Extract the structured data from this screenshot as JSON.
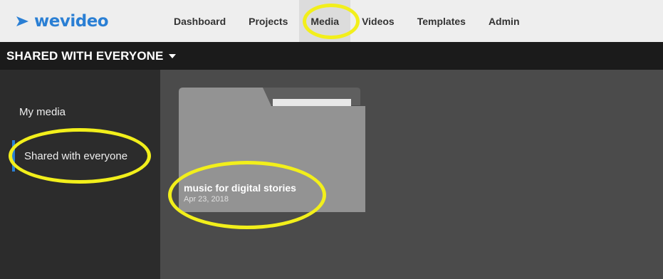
{
  "app": {
    "logo_text": "wevideo",
    "colors": {
      "brand_blue": "#2a7fd4",
      "highlight_yellow": "#f2ef1b"
    }
  },
  "nav": {
    "items": [
      {
        "label": "Dashboard"
      },
      {
        "label": "Projects"
      },
      {
        "label": "Media",
        "active": true
      },
      {
        "label": "Videos"
      },
      {
        "label": "Templates"
      },
      {
        "label": "Admin"
      }
    ]
  },
  "section": {
    "title": "SHARED WITH EVERYONE",
    "dropdown_icon": "caret-down-icon"
  },
  "sidebar": {
    "items": [
      {
        "label": "My media"
      },
      {
        "label": "Shared with everyone",
        "selected": true
      }
    ]
  },
  "folders": [
    {
      "name": "music for digital stories",
      "date": "Apr 23, 2018",
      "icon": "folder-icon"
    }
  ]
}
